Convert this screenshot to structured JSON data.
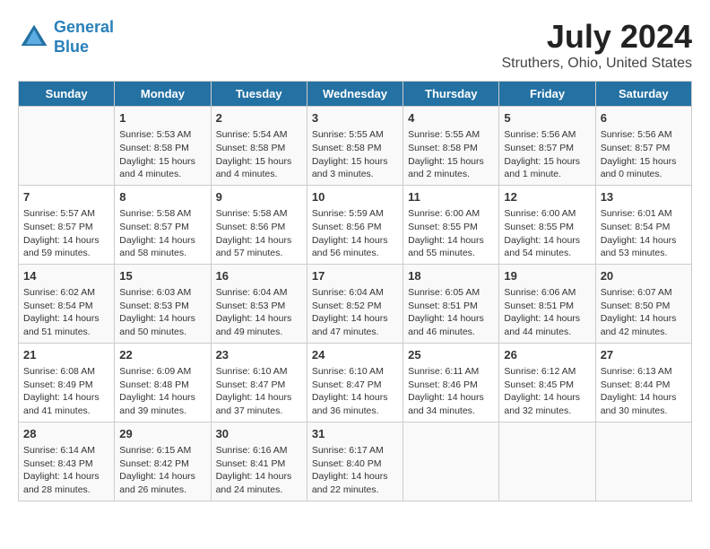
{
  "header": {
    "logo_line1": "General",
    "logo_line2": "Blue",
    "title": "July 2024",
    "subtitle": "Struthers, Ohio, United States"
  },
  "weekdays": [
    "Sunday",
    "Monday",
    "Tuesday",
    "Wednesday",
    "Thursday",
    "Friday",
    "Saturday"
  ],
  "weeks": [
    [
      {
        "day": "",
        "info": ""
      },
      {
        "day": "1",
        "info": "Sunrise: 5:53 AM\nSunset: 8:58 PM\nDaylight: 15 hours\nand 4 minutes."
      },
      {
        "day": "2",
        "info": "Sunrise: 5:54 AM\nSunset: 8:58 PM\nDaylight: 15 hours\nand 4 minutes."
      },
      {
        "day": "3",
        "info": "Sunrise: 5:55 AM\nSunset: 8:58 PM\nDaylight: 15 hours\nand 3 minutes."
      },
      {
        "day": "4",
        "info": "Sunrise: 5:55 AM\nSunset: 8:58 PM\nDaylight: 15 hours\nand 2 minutes."
      },
      {
        "day": "5",
        "info": "Sunrise: 5:56 AM\nSunset: 8:57 PM\nDaylight: 15 hours\nand 1 minute."
      },
      {
        "day": "6",
        "info": "Sunrise: 5:56 AM\nSunset: 8:57 PM\nDaylight: 15 hours\nand 0 minutes."
      }
    ],
    [
      {
        "day": "7",
        "info": "Sunrise: 5:57 AM\nSunset: 8:57 PM\nDaylight: 14 hours\nand 59 minutes."
      },
      {
        "day": "8",
        "info": "Sunrise: 5:58 AM\nSunset: 8:57 PM\nDaylight: 14 hours\nand 58 minutes."
      },
      {
        "day": "9",
        "info": "Sunrise: 5:58 AM\nSunset: 8:56 PM\nDaylight: 14 hours\nand 57 minutes."
      },
      {
        "day": "10",
        "info": "Sunrise: 5:59 AM\nSunset: 8:56 PM\nDaylight: 14 hours\nand 56 minutes."
      },
      {
        "day": "11",
        "info": "Sunrise: 6:00 AM\nSunset: 8:55 PM\nDaylight: 14 hours\nand 55 minutes."
      },
      {
        "day": "12",
        "info": "Sunrise: 6:00 AM\nSunset: 8:55 PM\nDaylight: 14 hours\nand 54 minutes."
      },
      {
        "day": "13",
        "info": "Sunrise: 6:01 AM\nSunset: 8:54 PM\nDaylight: 14 hours\nand 53 minutes."
      }
    ],
    [
      {
        "day": "14",
        "info": "Sunrise: 6:02 AM\nSunset: 8:54 PM\nDaylight: 14 hours\nand 51 minutes."
      },
      {
        "day": "15",
        "info": "Sunrise: 6:03 AM\nSunset: 8:53 PM\nDaylight: 14 hours\nand 50 minutes."
      },
      {
        "day": "16",
        "info": "Sunrise: 6:04 AM\nSunset: 8:53 PM\nDaylight: 14 hours\nand 49 minutes."
      },
      {
        "day": "17",
        "info": "Sunrise: 6:04 AM\nSunset: 8:52 PM\nDaylight: 14 hours\nand 47 minutes."
      },
      {
        "day": "18",
        "info": "Sunrise: 6:05 AM\nSunset: 8:51 PM\nDaylight: 14 hours\nand 46 minutes."
      },
      {
        "day": "19",
        "info": "Sunrise: 6:06 AM\nSunset: 8:51 PM\nDaylight: 14 hours\nand 44 minutes."
      },
      {
        "day": "20",
        "info": "Sunrise: 6:07 AM\nSunset: 8:50 PM\nDaylight: 14 hours\nand 42 minutes."
      }
    ],
    [
      {
        "day": "21",
        "info": "Sunrise: 6:08 AM\nSunset: 8:49 PM\nDaylight: 14 hours\nand 41 minutes."
      },
      {
        "day": "22",
        "info": "Sunrise: 6:09 AM\nSunset: 8:48 PM\nDaylight: 14 hours\nand 39 minutes."
      },
      {
        "day": "23",
        "info": "Sunrise: 6:10 AM\nSunset: 8:47 PM\nDaylight: 14 hours\nand 37 minutes."
      },
      {
        "day": "24",
        "info": "Sunrise: 6:10 AM\nSunset: 8:47 PM\nDaylight: 14 hours\nand 36 minutes."
      },
      {
        "day": "25",
        "info": "Sunrise: 6:11 AM\nSunset: 8:46 PM\nDaylight: 14 hours\nand 34 minutes."
      },
      {
        "day": "26",
        "info": "Sunrise: 6:12 AM\nSunset: 8:45 PM\nDaylight: 14 hours\nand 32 minutes."
      },
      {
        "day": "27",
        "info": "Sunrise: 6:13 AM\nSunset: 8:44 PM\nDaylight: 14 hours\nand 30 minutes."
      }
    ],
    [
      {
        "day": "28",
        "info": "Sunrise: 6:14 AM\nSunset: 8:43 PM\nDaylight: 14 hours\nand 28 minutes."
      },
      {
        "day": "29",
        "info": "Sunrise: 6:15 AM\nSunset: 8:42 PM\nDaylight: 14 hours\nand 26 minutes."
      },
      {
        "day": "30",
        "info": "Sunrise: 6:16 AM\nSunset: 8:41 PM\nDaylight: 14 hours\nand 24 minutes."
      },
      {
        "day": "31",
        "info": "Sunrise: 6:17 AM\nSunset: 8:40 PM\nDaylight: 14 hours\nand 22 minutes."
      },
      {
        "day": "",
        "info": ""
      },
      {
        "day": "",
        "info": ""
      },
      {
        "day": "",
        "info": ""
      }
    ]
  ]
}
